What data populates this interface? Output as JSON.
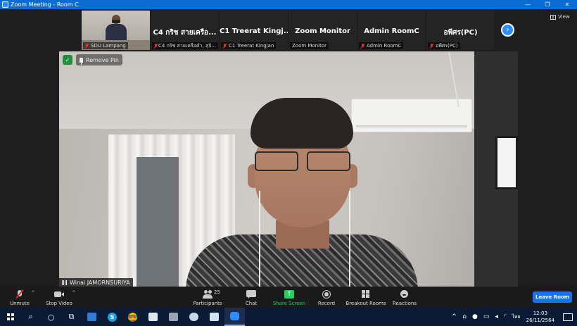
{
  "window": {
    "title": "Zoom Meeting - Room C",
    "minimize": "—",
    "restore": "❐",
    "close": "✕"
  },
  "view_button": {
    "label": "View",
    "icon": "grid-icon"
  },
  "participants_strip": [
    {
      "label": "SDU Lampang",
      "big_name": "",
      "muted": true,
      "has_video": true
    },
    {
      "label": "C4 กริช สายเครือคำ, สุจิ...",
      "big_name": "C4 กริช สายเครือ...",
      "muted": true,
      "has_video": false
    },
    {
      "label": "C1 Treerat Kingjan",
      "big_name": "C1 Treerat Kingj...",
      "muted": true,
      "has_video": false
    },
    {
      "label": "Zoom Monitor",
      "big_name": "Zoom Monitor",
      "muted": false,
      "has_video": false
    },
    {
      "label": "Admin RoomC",
      "big_name": "Admin RoomC",
      "muted": true,
      "has_video": false
    },
    {
      "label": "อพีศร(PC)",
      "big_name": "อพีศร(PC)",
      "muted": true,
      "has_video": false
    }
  ],
  "main_video": {
    "remove_pin_label": "Remove Pin",
    "speaker_name": "Winai JAMORNSURIYA"
  },
  "toolbar": {
    "unmute": "Unmute",
    "stop_video": "Stop Video",
    "participants": "Participants",
    "participants_count": "25",
    "chat": "Chat",
    "share_screen": "Share Screen",
    "record": "Record",
    "breakout_rooms": "Breakout Rooms",
    "reactions": "Reactions",
    "leave_room": "Leave Room",
    "caret": "^"
  },
  "taskbar": {
    "time": "12:03",
    "date": "26/11/2564",
    "language": "ไทย",
    "apps": [
      {
        "name": "start-button",
        "glyph": ""
      },
      {
        "name": "search",
        "glyph": "⌕"
      },
      {
        "name": "cortana",
        "glyph": "○"
      },
      {
        "name": "task-view",
        "glyph": "⧉"
      },
      {
        "name": "outlook",
        "glyph": ""
      },
      {
        "name": "skype",
        "glyph": "S"
      },
      {
        "name": "chrome",
        "glyph": ""
      },
      {
        "name": "onedrive",
        "glyph": ""
      },
      {
        "name": "camera",
        "glyph": ""
      },
      {
        "name": "paint",
        "glyph": ""
      },
      {
        "name": "files",
        "glyph": ""
      },
      {
        "name": "zoom",
        "glyph": ""
      }
    ]
  },
  "colors": {
    "zoom_blue": "#0d6cd1",
    "share_green": "#23d160",
    "leave_blue": "#1a73e8",
    "muted_red": "#e0312f"
  }
}
